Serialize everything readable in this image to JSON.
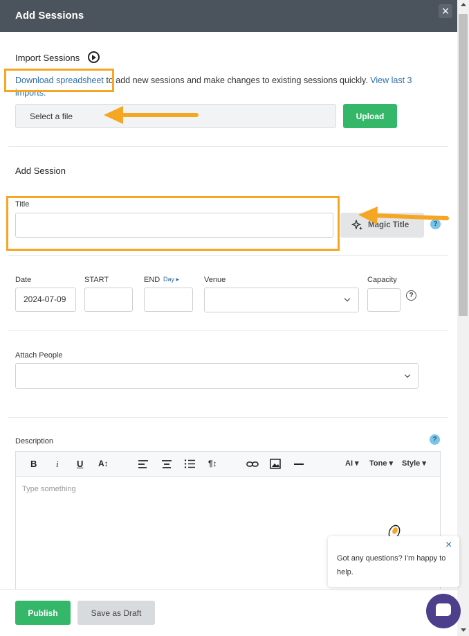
{
  "header": {
    "title": "Add Sessions",
    "close_icon": "close-icon"
  },
  "import": {
    "title": "Import Sessions",
    "download_link": "Download spreadsheet",
    "description": " to add new sessions and make changes to existing sessions quickly. ",
    "view_link": "View last 3 imports.",
    "file_label": "Select a file",
    "upload_label": "Upload"
  },
  "session": {
    "title": "Add Session",
    "title_label": "Title",
    "title_value": "",
    "magic_label": "Magic Title",
    "date_label": "Date",
    "date_value": "2024-07-09",
    "start_label": "START",
    "end_label": "END",
    "day_link": "Day",
    "venue_label": "Venue",
    "capacity_label": "Capacity"
  },
  "people": {
    "label": "Attach People"
  },
  "description": {
    "label": "Description",
    "placeholder": "Type something",
    "toolbar": {
      "bold": "B",
      "italic": "i",
      "underline": "U",
      "font_size": "A↕",
      "paragraph": "¶↕",
      "ai": "AI",
      "tone": "Tone",
      "style": "Style"
    }
  },
  "footer": {
    "publish_label": "Publish",
    "draft_label": "Save as Draft"
  },
  "chat": {
    "message": "Got any questions? I'm happy to help."
  },
  "help_mark": "?",
  "colors": {
    "header_bg": "#4b545c",
    "accent_green": "#35b76a",
    "link_blue": "#2a6ea8",
    "highlight_orange": "#f5a623",
    "chat_purple": "#4d3f8c"
  }
}
